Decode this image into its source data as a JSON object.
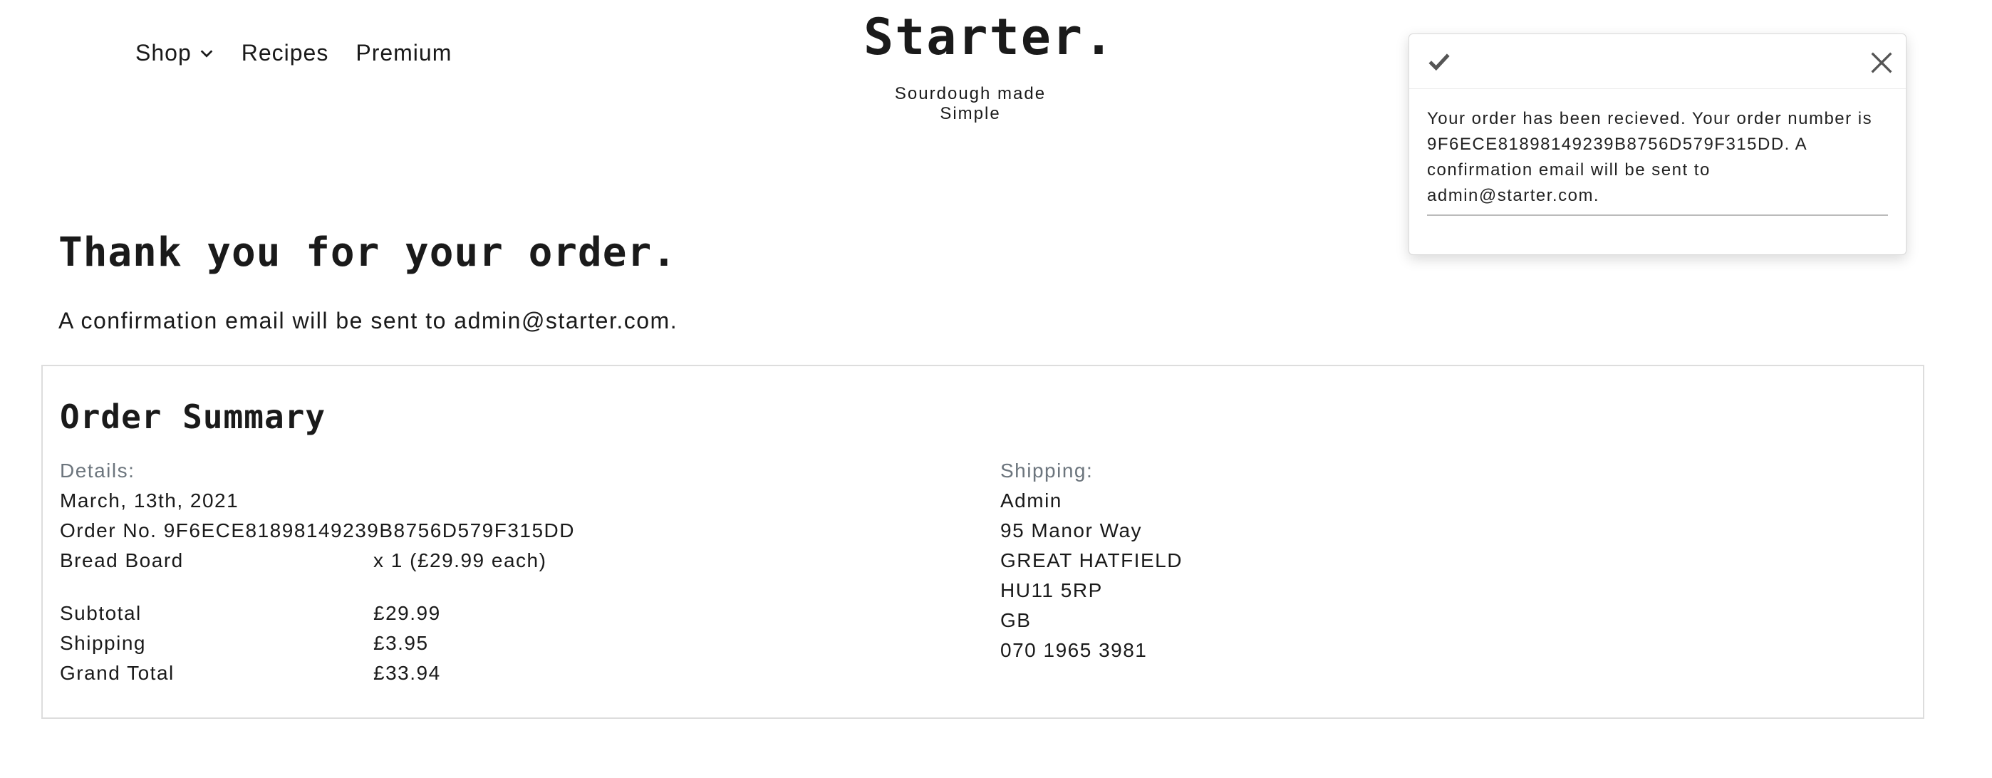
{
  "nav": {
    "shop": "Shop",
    "recipes": "Recipes",
    "premium": "Premium"
  },
  "brand": {
    "name": "Starter.",
    "tagline": "Sourdough made Simple"
  },
  "toast": {
    "message": "Your order has been recieved. Your order number is 9F6ECE81898149239B8756D579F315DD. A confirmation email will be sent to admin@starter.com."
  },
  "page": {
    "heading": "Thank you for your order.",
    "confirm_prefix": "A confirmation email will be sent to ",
    "email": "admin@starter.com",
    "confirm_suffix": "."
  },
  "summary": {
    "title": "Order Summary",
    "details_label": "Details:",
    "date": "March, 13th, 2021",
    "order_no_label": "Order No.",
    "order_no": "9F6ECE81898149239B8756D579F315DD",
    "items": [
      {
        "name": "Bread Board",
        "qty": "x 1 (£29.99 each)"
      }
    ],
    "subtotal_label": "Subtotal",
    "subtotal": "£29.99",
    "shipping_label": "Shipping",
    "shipping": "£3.95",
    "grand_total_label": "Grand Total",
    "grand_total": "£33.94",
    "shipping_heading": "Shipping:",
    "ship_name": "Admin",
    "ship_street": "95 Manor Way",
    "ship_town": "GREAT HATFIELD",
    "ship_postcode": "HU11 5RP",
    "ship_country": "GB",
    "ship_phone": "070 1965 3981"
  },
  "icons": {
    "chevron": "chevron-down-icon",
    "check": "check-icon",
    "close": "close-icon"
  },
  "colors": {
    "text": "#1a1a1a",
    "muted": "#6c757d",
    "border": "#dddddd"
  }
}
